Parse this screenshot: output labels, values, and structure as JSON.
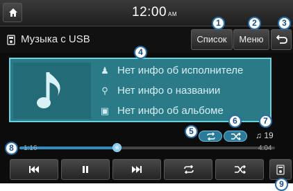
{
  "header": {
    "time": "12:00",
    "ampm": "AM"
  },
  "source": {
    "title": "Музыка с USB",
    "icon": "usb-music-icon"
  },
  "buttons": {
    "list": "Список",
    "menu": "Меню"
  },
  "info": {
    "artist": "Нет инфо об исполнителе",
    "title": "Нет инфо о названии",
    "album": "Нет инфо об альбоме"
  },
  "status": {
    "track": "19"
  },
  "progress": {
    "elapsed": "1:16",
    "total": "4:04",
    "fraction": 0.38
  },
  "callouts": [
    "1",
    "2",
    "3",
    "4",
    "5",
    "6",
    "7",
    "8",
    "9"
  ],
  "colors": {
    "panel": "#2a7a88",
    "accent": "#2e8ec2",
    "callout": "#2a6fa8"
  }
}
